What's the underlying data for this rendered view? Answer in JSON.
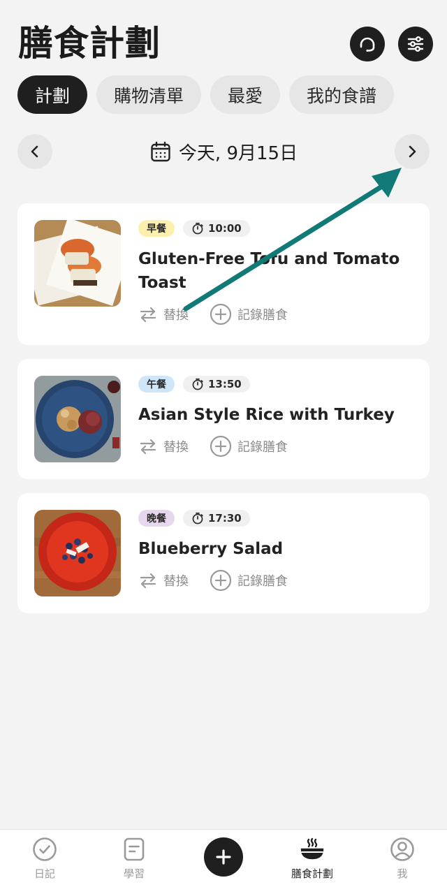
{
  "header": {
    "title": "膳食計劃",
    "support_icon": "headset-icon",
    "filter_icon": "sliders-icon"
  },
  "tabs": [
    {
      "label": "計劃",
      "active": true
    },
    {
      "label": "購物清單",
      "active": false
    },
    {
      "label": "最愛",
      "active": false
    },
    {
      "label": "我的食譜",
      "active": false
    }
  ],
  "date_nav": {
    "label": "今天, 9月15日",
    "prev_icon": "chevron-left-icon",
    "next_icon": "chevron-right-icon"
  },
  "meals": [
    {
      "type": "早餐",
      "type_color": "#fdefae",
      "time": "10:00",
      "name_line1": "Gluten-Free Tofu and Tomato",
      "name_line2": "Toast",
      "swap_label": "替換",
      "log_label": "記錄膳食"
    },
    {
      "type": "午餐",
      "type_color": "#cfe6f8",
      "time": "13:50",
      "name_line1": "Asian Style Rice with Turkey",
      "swap_label": "替換",
      "log_label": "記錄膳食"
    },
    {
      "type": "晚餐",
      "type_color": "#e7d7ee",
      "time": "17:30",
      "name_line1": "Blueberry Salad",
      "swap_label": "替換",
      "log_label": "記錄膳食"
    }
  ],
  "annotation": {
    "color": "#117a76"
  },
  "bottom_nav": [
    {
      "label": "日記",
      "icon": "check-circle-icon",
      "active": false
    },
    {
      "label": "學習",
      "icon": "document-icon",
      "active": false
    },
    {
      "label": "",
      "icon": "plus-icon",
      "active": false
    },
    {
      "label": "膳食計劃",
      "icon": "bowl-icon",
      "active": true
    },
    {
      "label": "我",
      "icon": "user-circle-icon",
      "active": false
    }
  ]
}
